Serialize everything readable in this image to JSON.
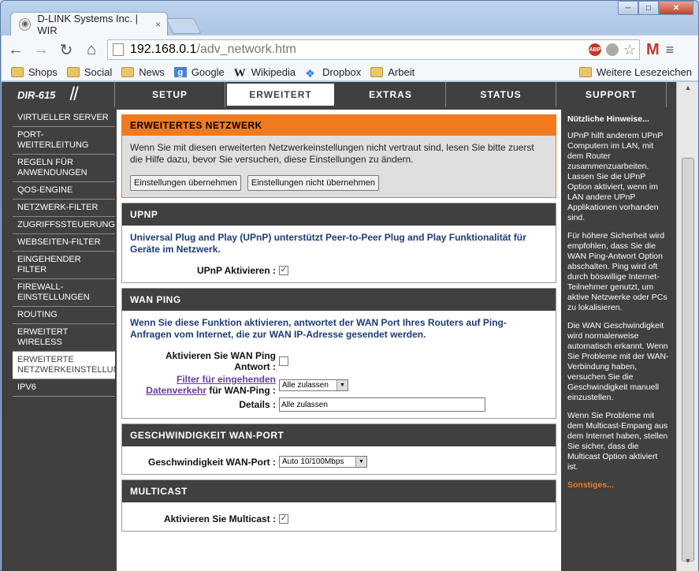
{
  "browser": {
    "tab_title": "D-LINK Systems Inc. | WIR",
    "tab_close": "×",
    "url_host": "192.168.0.1",
    "url_path": "/adv_network.htm",
    "abp_label": "ABP",
    "window_buttons": {
      "minimize": "─",
      "maximize": "□",
      "close": "✕"
    },
    "icons": [
      "back-icon",
      "forward-icon",
      "reload-icon",
      "home-icon",
      "star-icon",
      "gmail-icon",
      "menu-icon"
    ]
  },
  "bookmarks": [
    {
      "label": "Shops",
      "icon": "folder"
    },
    {
      "label": "Social",
      "icon": "folder"
    },
    {
      "label": "News",
      "icon": "folder"
    },
    {
      "label": "Google",
      "icon": "google"
    },
    {
      "label": "Wikipedia",
      "icon": "wikipedia"
    },
    {
      "label": "Dropbox",
      "icon": "dropbox"
    },
    {
      "label": "Arbeit",
      "icon": "folder"
    }
  ],
  "bookmarks_other": "Weitere Lesezeichen",
  "router": {
    "model": "DIR-615",
    "nav": [
      "SETUP",
      "ERWEITERT",
      "EXTRAS",
      "STATUS",
      "SUPPORT"
    ],
    "active_nav": "ERWEITERT"
  },
  "sidebar": [
    "VIRTUELLER SERVER",
    "PORT-WEITERLEITUNG",
    "REGELN FÜR ANWENDUNGEN",
    "QOS-ENGINE",
    "NETZWERK-FILTER",
    "ZUGRIFFSSTEUERUNG",
    "WEBSEITEN-FILTER",
    "EINGEHENDER FILTER",
    "FIREWALL-EINSTELLUNGEN",
    "ROUTING",
    "ERWEITERT WIRELESS",
    "ERWEITERTE NETZWERKEINSTELLUNGEN",
    "IPV6"
  ],
  "warn": {
    "title": "ERWEITERTES NETZWERK",
    "text": "Wenn Sie mit diesen erweiterten Netzwerkeinstellungen nicht vertraut sind, lesen Sie bitte zuerst die Hilfe dazu, bevor Sie versuchen, diese Einstellungen zu ändern.",
    "save": "Einstellungen übernehmen",
    "dont_save": "Einstellungen nicht übernehmen"
  },
  "upnp": {
    "title": "UPNP",
    "desc": "Universal Plug and Play (UPnP) unterstützt Peer-to-Peer Plug and Play Funktionalität für Geräte im Netzwerk.",
    "enable_label": "UPnP Aktivieren :",
    "enabled": "✓"
  },
  "wanping": {
    "title": "WAN PING",
    "desc": "Wenn Sie diese Funktion aktivieren, antwortet der WAN Port Ihres Routers auf Ping-Anfragen vom Internet, die zur WAN IP-Adresse gesendet werden.",
    "enable_label": "Aktivieren Sie WAN Ping Antwort :",
    "filter_link": "Filter für eingehenden Datenverkehr",
    "filter_suffix": " für WAN-Ping :",
    "filter_value": "Alle zulassen",
    "details_label": "Details :",
    "details_value": "Alle zulassen"
  },
  "wanspeed": {
    "title": "GESCHWINDIGKEIT WAN-PORT",
    "label": "Geschwindigkeit WAN-Port :",
    "value": "Auto 10/100Mbps"
  },
  "multicast": {
    "title": "MULTICAST",
    "label": "Aktivieren Sie Multicast :",
    "enabled": "✓"
  },
  "hints": {
    "title": "Nützliche Hinweise...",
    "p1": "UPnP hilft anderem UPnP Computern im LAN, mit dem Router zusammenzuarbeiten. Lassen Sie die UPnP Option aktiviert, wenn im LAN andere UPnP Applikationen vorhanden sind.",
    "p2": "Für höhere Sicherheit wird empfohlen, dass Sie die WAN Ping-Antwort Option abschalten. Ping wird oft durch böswillige Internet-Teilnehmer genutzt, um aktive Netzwerke oder PCs zu lokalisieren.",
    "p3": "Die WAN Geschwindigkeit wird normalerweise automatisch erkannt. Wenn Sie Probleme mit der WAN-Verbindung haben, versuchen Sie die Geschwindigkeit manuell einzustellen.",
    "p4": "Wenn Sie Probleme mit dem Multicast-Empang aus dem Internet haben, stellen Sie sicher, dass die Multicast Option aktiviert ist.",
    "more": "Sonstiges..."
  }
}
